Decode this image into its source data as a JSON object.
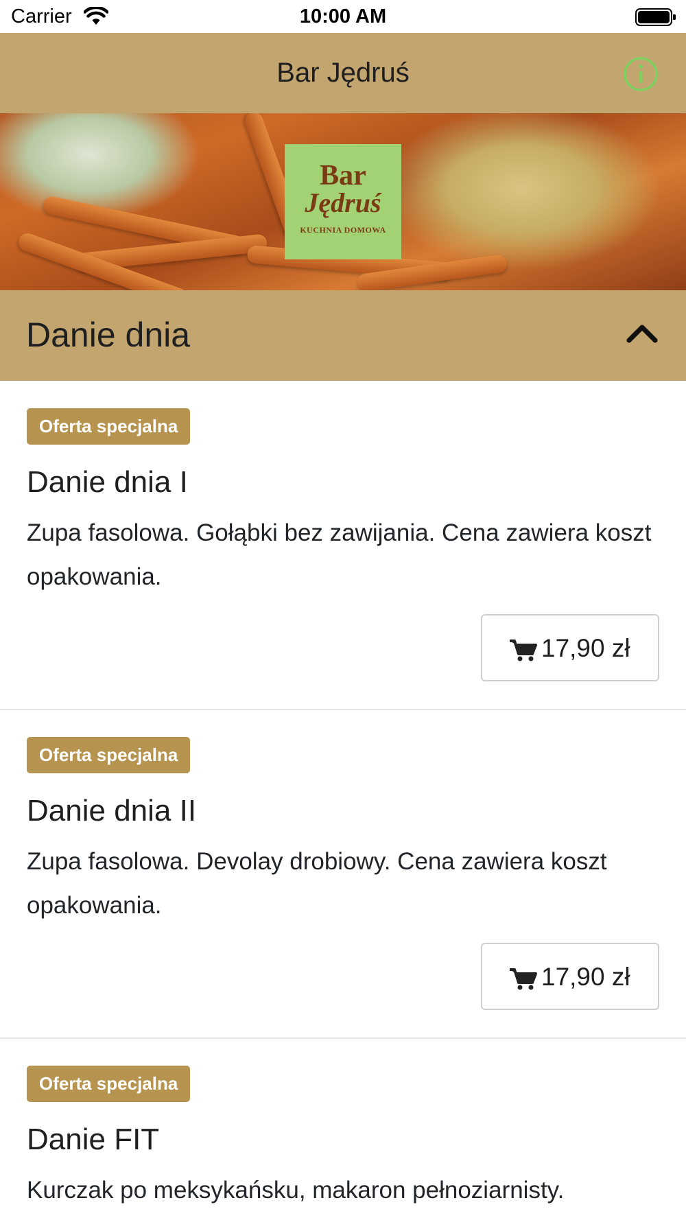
{
  "status_bar": {
    "carrier": "Carrier",
    "time": "10:00 AM"
  },
  "nav": {
    "title": "Bar Jędruś",
    "info_icon": "info-circle-icon"
  },
  "hero": {
    "logo": {
      "line1": "Bar",
      "line2": "Jędruś",
      "line3": "KUCHNIA DOMOWA"
    }
  },
  "section": {
    "title": "Danie dnia",
    "toggle_icon": "chevron-up-icon"
  },
  "items": [
    {
      "badge": "Oferta specjalna",
      "title": "Danie dnia I",
      "description": "Zupa fasolowa. Gołąbki bez zawijania. Cena zawiera koszt opakowania.",
      "price": "17,90 zł"
    },
    {
      "badge": "Oferta specjalna",
      "title": "Danie dnia II",
      "description": "Zupa fasolowa. Devolay drobiowy. Cena zawiera koszt opakowania.",
      "price": "17,90 zł"
    },
    {
      "badge": "Oferta specjalna",
      "title": "Danie FIT",
      "description": "Kurczak po meksykańsku, makaron pełnoziarnisty.",
      "price": ""
    }
  ],
  "colors": {
    "header_bg": "#c3a56f",
    "badge_bg": "#b6944f",
    "info_icon": "#7fd15f",
    "logo_bg": "#a2d273"
  }
}
